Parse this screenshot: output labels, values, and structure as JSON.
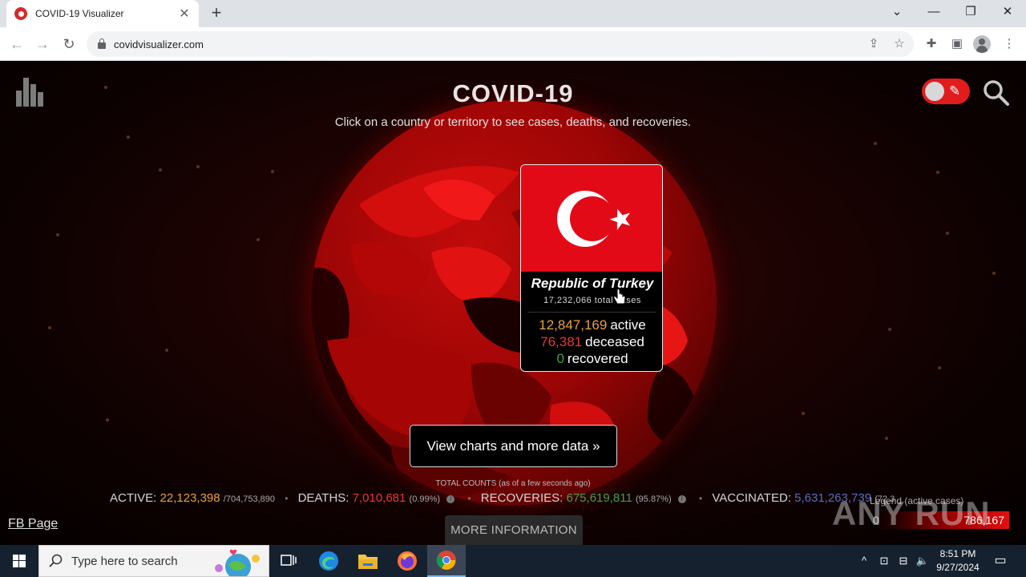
{
  "browser": {
    "tab_title": "COVID-19 Visualizer",
    "tab_close": "✕",
    "new_tab": "+",
    "url": "covidvisualizer.com"
  },
  "page": {
    "title": "COVID-19",
    "subtitle": "Click on a country or territory to see cases, deaths, and recoveries.",
    "card": {
      "country": "Republic of Turkey",
      "total_cases": "17,232,066 total cases",
      "active_value": "12,847,169",
      "active_label": "active",
      "deceased_value": "76,381",
      "deceased_label": "deceased",
      "recovered_value": "0",
      "recovered_label": "recovered"
    },
    "cta_label": "View charts and more data »",
    "total_counts_caption": "TOTAL COUNTS (as of a few seconds ago)",
    "stats": {
      "active_label": "ACTIVE:",
      "active_value": "22,123,398",
      "active_total": "/704,753,890",
      "deaths_label": "DEATHS:",
      "deaths_value": "7,010,681",
      "deaths_pct": "(0.99%)",
      "recoveries_label": "RECOVERIES:",
      "recoveries_value": "675,619,811",
      "recoveries_pct": "(95.87%)",
      "vaccinated_label": "VACCINATED:",
      "vaccinated_value": "5,631,263,739",
      "vaccinated_pct": "(72.3"
    },
    "fb_link": "FB Page",
    "more_info": "MORE INFORMATION",
    "legend": {
      "label": "Legend (active cases)",
      "min": "0",
      "max": "786,167"
    },
    "watermark": "ANY RUN"
  },
  "colors": {
    "active": "#e8a33a",
    "deaths": "#e53935",
    "recoveries": "#43a047",
    "vaccinated": "#5c6bc0",
    "accent": "#e11c1c"
  },
  "taskbar": {
    "search_placeholder": "Type here to search",
    "time": "8:51 PM",
    "date": "9/27/2024"
  }
}
